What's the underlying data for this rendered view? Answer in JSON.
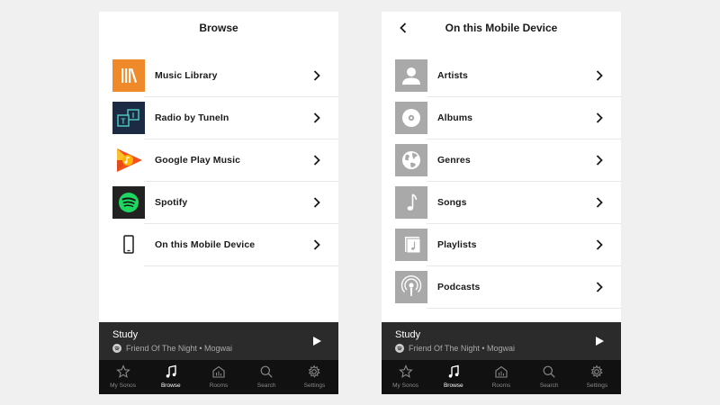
{
  "left_screen": {
    "header": {
      "title": "Browse"
    },
    "rows": [
      {
        "label": "Music Library",
        "icon": "music-library-icon"
      },
      {
        "label": "Radio by TuneIn",
        "icon": "tunein-icon"
      },
      {
        "label": "Google Play Music",
        "icon": "google-play-music-icon"
      },
      {
        "label": "Spotify",
        "icon": "spotify-icon"
      },
      {
        "label": "On this Mobile Device",
        "icon": "mobile-device-icon"
      }
    ]
  },
  "right_screen": {
    "header": {
      "title": "On this Mobile Device"
    },
    "rows": [
      {
        "label": "Artists",
        "icon": "artist-icon"
      },
      {
        "label": "Albums",
        "icon": "album-icon"
      },
      {
        "label": "Genres",
        "icon": "globe-icon"
      },
      {
        "label": "Songs",
        "icon": "music-note-icon"
      },
      {
        "label": "Playlists",
        "icon": "playlist-icon"
      },
      {
        "label": "Podcasts",
        "icon": "podcast-icon"
      }
    ]
  },
  "now_playing": {
    "title": "Study",
    "subtitle": "Friend Of The Night • Mogwai"
  },
  "tabbar": {
    "tabs": [
      {
        "label": "My Sonos",
        "icon": "star-icon",
        "active": false
      },
      {
        "label": "Browse",
        "icon": "music-note-icon",
        "active": true
      },
      {
        "label": "Rooms",
        "icon": "rooms-icon",
        "active": false
      },
      {
        "label": "Search",
        "icon": "search-icon",
        "active": false
      },
      {
        "label": "Settings",
        "icon": "gear-icon",
        "active": false
      }
    ]
  },
  "colors": {
    "background": "#f0f0f0",
    "now_playing_bg": "#2b2b2b",
    "tabbar_bg": "#111111",
    "music_library_orange": "#ee8a2a",
    "tunein_navy": "#1c2a44",
    "tunein_teal": "#4fd1c5",
    "spotify_green": "#1ed760",
    "tile_gray": "#a9a9a9"
  }
}
